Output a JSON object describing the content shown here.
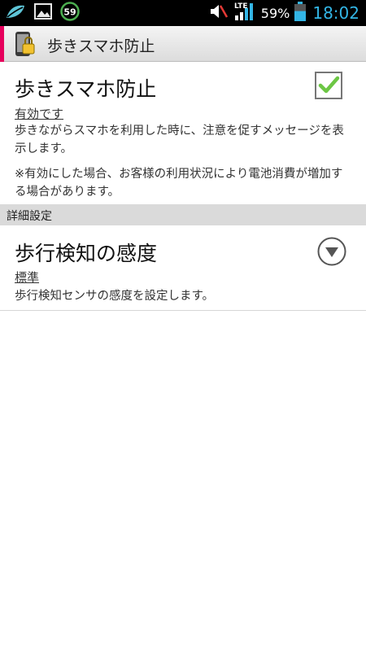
{
  "status_bar": {
    "battery_percent": "59%",
    "battery_level": 0.59,
    "network_type": "LTE",
    "notification_badge": "59",
    "time": "18:02",
    "clock_color": "#33b5e5",
    "icons": [
      "leaf-icon",
      "image-icon",
      "badge-icon",
      "mute-icon",
      "signal-icon",
      "battery-icon"
    ]
  },
  "action_bar": {
    "title": "歩きスマホ防止",
    "accent_color": "#e6005c"
  },
  "prefs": {
    "walk_prevent": {
      "title": "歩きスマホ防止",
      "summary": "有効です",
      "desc1": "歩きながらスマホを利用した時に、注意を促すメッセージを表示します。",
      "desc2": "※有効にした場合、お客様の利用状況により電池消費が増加する場合があります。",
      "checked": true
    },
    "section_header": "詳細設定",
    "sensitivity": {
      "title": "歩行検知の感度",
      "summary": "標準",
      "desc": "歩行検知センサの感度を設定します。"
    }
  }
}
